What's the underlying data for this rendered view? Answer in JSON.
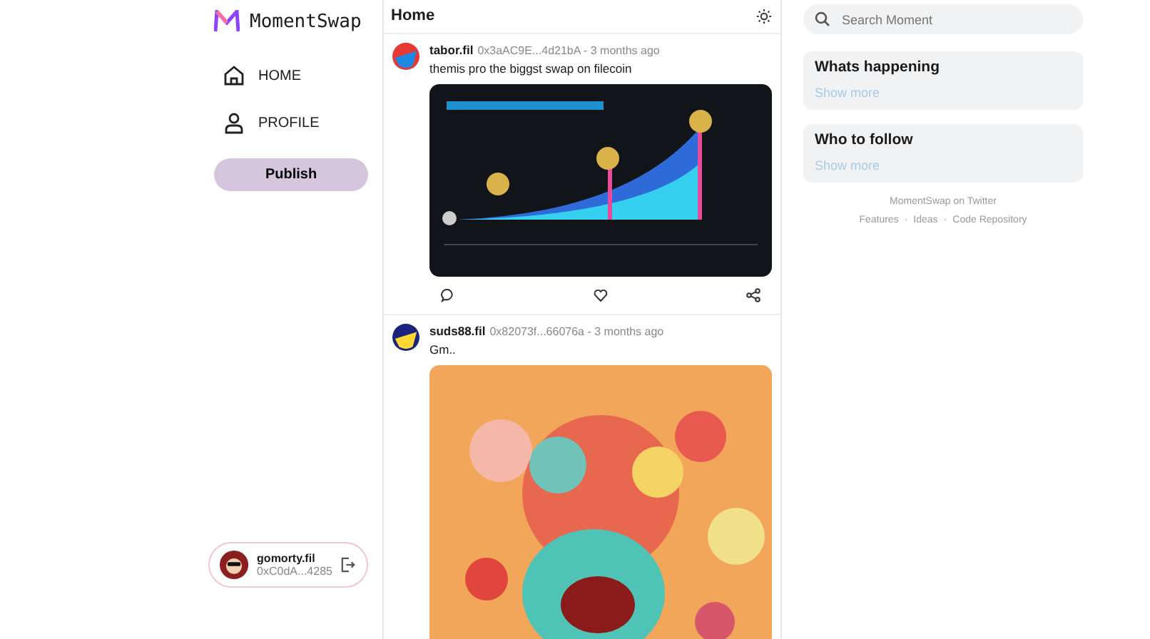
{
  "brand": {
    "name": "MomentSwap"
  },
  "nav": [
    {
      "label": "HOME",
      "kind": "home",
      "selected": false
    },
    {
      "label": "PROFILE",
      "kind": "profile",
      "selected": false
    }
  ],
  "publish_button": "Publish",
  "account": {
    "name": "gomorty.fil",
    "address": "0xC0dA...4285"
  },
  "feed": {
    "title": "Home",
    "posts": [
      {
        "author": "tabor.fil",
        "address": "0x3aAC9E...4d21bA",
        "separator": "-",
        "time": "3 months ago",
        "text": "themis pro the biggst swap on filecoin"
      },
      {
        "author": "suds88.fil",
        "address": "0x82073f...66076a",
        "separator": "-",
        "time": "3 months ago",
        "text": "Gm.."
      }
    ]
  },
  "search": {
    "placeholder": "Search Moment"
  },
  "panels": [
    {
      "title": "Whats happening",
      "link": "Show more"
    },
    {
      "title": "Who to follow",
      "link": "Show more"
    }
  ],
  "footer": {
    "line": "MomentSwap on Twitter",
    "separator": "·",
    "links": [
      "Features",
      "Ideas",
      "Code Repository"
    ]
  }
}
